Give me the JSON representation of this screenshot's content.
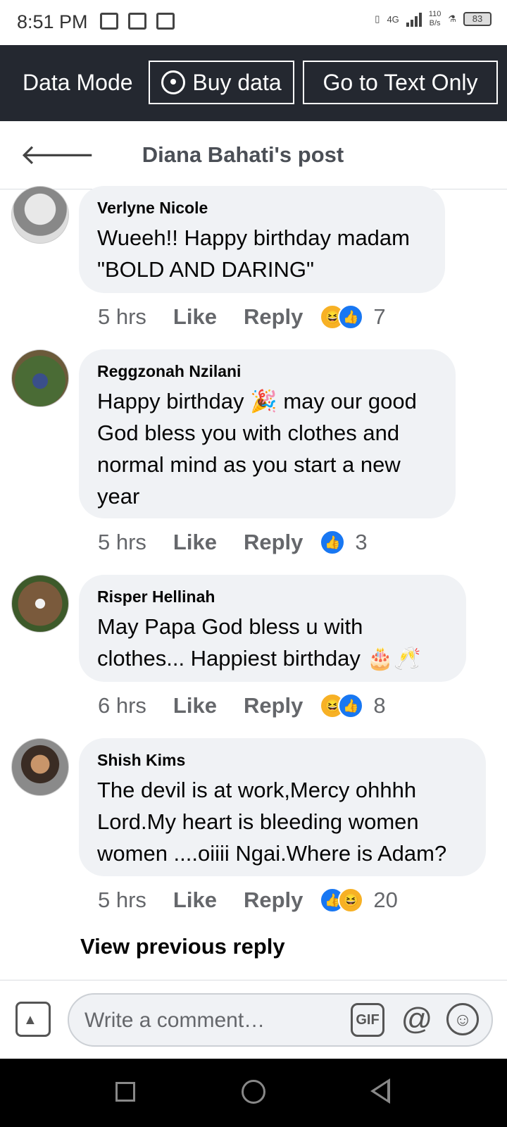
{
  "status": {
    "time": "8:51 PM",
    "network": "4G",
    "speed_value": "110",
    "speed_unit": "B/s",
    "battery": "83"
  },
  "datamode": {
    "label": "Data Mode",
    "buy_label": "Buy data",
    "textonly_label": "Go to Text Only"
  },
  "header": {
    "title": "Diana  Bahati's post"
  },
  "comments": [
    {
      "name": "Verlyne Nicole",
      "text": "Wueeh!! Happy birthday madam \"BOLD AND DARING\"",
      "time": "5 hrs",
      "like": "Like",
      "reply": "Reply",
      "reactions": [
        "haha",
        "like"
      ],
      "count": "7"
    },
    {
      "name": "Reggzonah Nzilani",
      "text": "Happy birthday 🎉 may our good God bless you with clothes and normal mind as you start a new year",
      "time": "5 hrs",
      "like": "Like",
      "reply": "Reply",
      "reactions": [
        "like"
      ],
      "count": "3"
    },
    {
      "name": "Risper Hellinah",
      "text": "May Papa God  bless u with clothes... Happiest birthday 🎂🥂",
      "time": "6 hrs",
      "like": "Like",
      "reply": "Reply",
      "reactions": [
        "haha",
        "like"
      ],
      "count": "8"
    },
    {
      "name": "Shish Kims",
      "text": "The devil is at work,Mercy ohhhh Lord.My heart is bleeding women women ....oiiii Ngai.Where is Adam?",
      "time": "5 hrs",
      "like": "Like",
      "reply": "Reply",
      "reactions": [
        "like",
        "haha"
      ],
      "count": "20"
    }
  ],
  "view_previous": "View previous reply",
  "composer": {
    "placeholder": "Write a comment…",
    "gif_label": "GIF",
    "at_label": "@"
  },
  "colors": {
    "dark_bar": "#242830",
    "bubble": "#f0f2f5",
    "like_blue": "#1877f2",
    "haha_yellow": "#f7b125"
  }
}
